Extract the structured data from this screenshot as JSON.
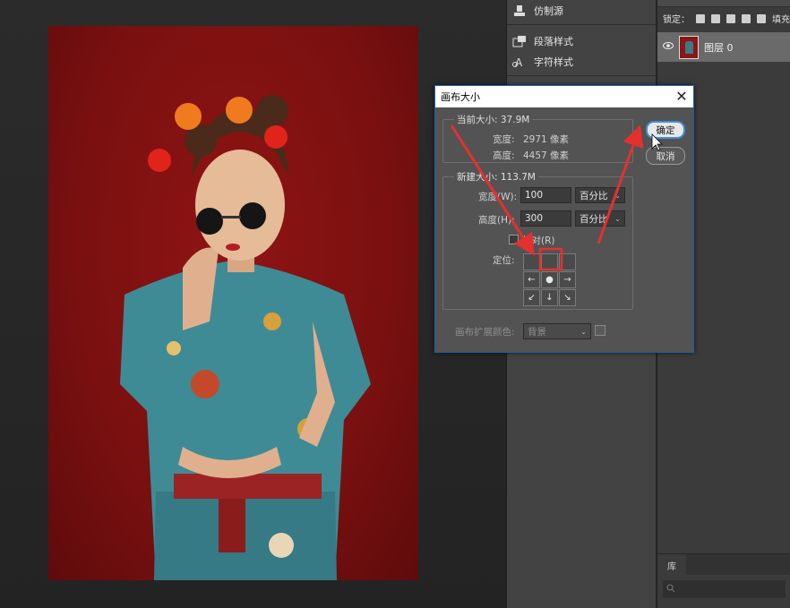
{
  "panels": {
    "clone_source": "仿制源",
    "paragraph_styles": "段落样式",
    "character_styles": "字符样式"
  },
  "layers": {
    "lock_label": "锁定：",
    "fill_label": "填充",
    "layer_name": "图层 0",
    "library_tab": "库"
  },
  "dialog": {
    "title": "画布大小",
    "close_glyph": "✕",
    "current_size_legend": "当前大小: 37.9M",
    "width_label": "宽度:",
    "width_value": "2971 像素",
    "height_label": "高度:",
    "height_value": "4457 像素",
    "new_size_legend": "新建大小: 113.7M",
    "new_width_label": "宽度(W):",
    "new_width_value": "100",
    "new_width_unit": "百分比",
    "new_height_label": "高度(H):",
    "new_height_value": "300",
    "new_height_unit": "百分比",
    "relative_label": "相对(R)",
    "anchor_label": "定位:",
    "anchor_cells": [
      "",
      "",
      "",
      "←",
      "●",
      "→",
      "↙",
      "↓",
      "↘"
    ],
    "ok_label": "确定",
    "cancel_label": "取消",
    "ext_color_label": "画布扩展颜色:",
    "ext_color_value": "背景"
  },
  "colors": {
    "annotation_red": "#e53030",
    "backdrop_red": "#8b1414",
    "dialog_focus_blue": "#3e8ee0"
  }
}
